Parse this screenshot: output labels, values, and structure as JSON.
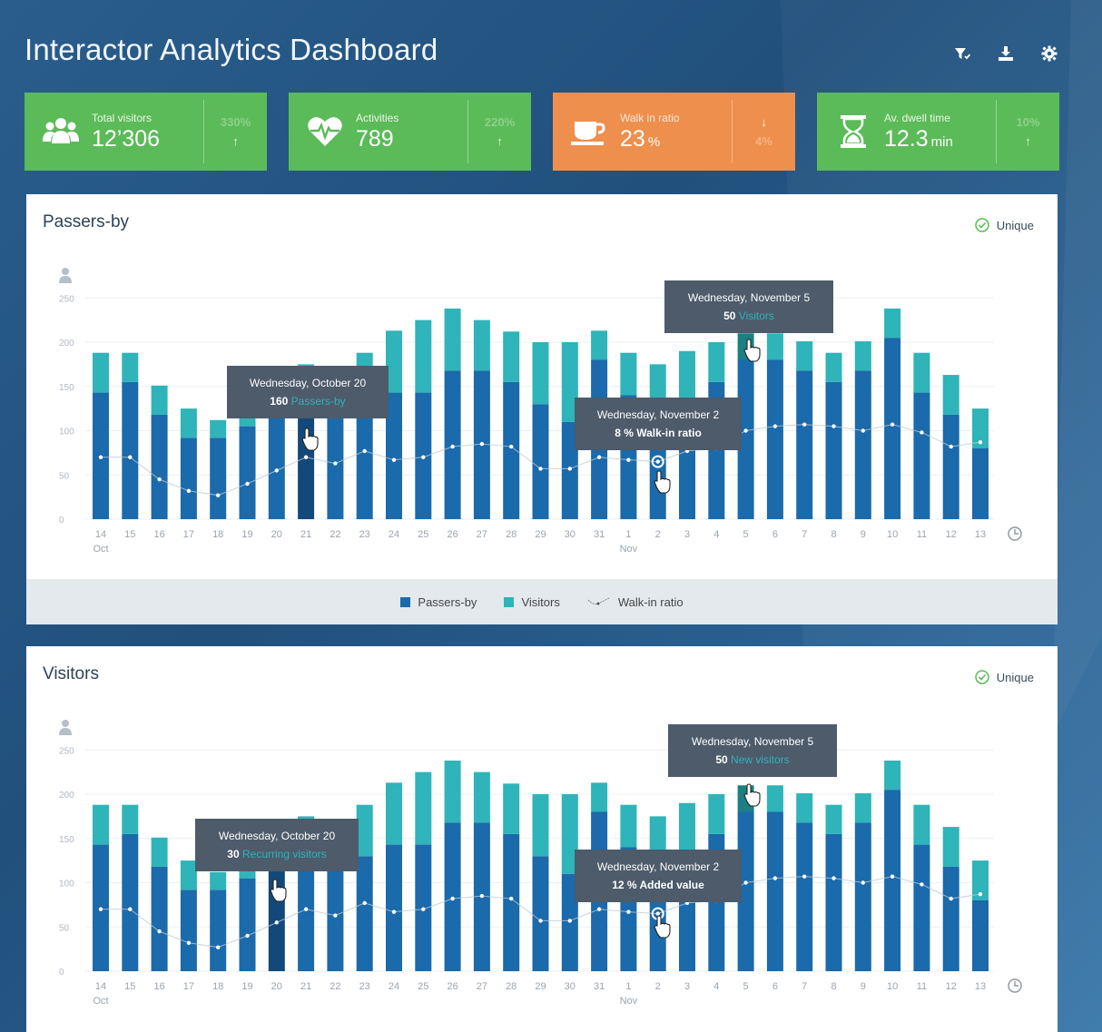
{
  "header": {
    "title": "Interactor Analytics Dashboard",
    "icons": [
      "filter-icon",
      "download-icon",
      "gear-icon"
    ]
  },
  "kpis": [
    {
      "label": "Total visitors",
      "value": "12’306",
      "unit": "",
      "pct": "330%",
      "arrow": "↑",
      "color": "green",
      "icon": "people-icon"
    },
    {
      "label": "Activities",
      "value": "789",
      "unit": "",
      "pct": "220%",
      "arrow": "↑",
      "color": "green",
      "icon": "heartbeat-icon"
    },
    {
      "label": "Walk in ratio",
      "value": "23",
      "unit": "%",
      "pct": "4%",
      "arrow": "↓",
      "color": "orange",
      "icon": "coffee-cup-icon"
    },
    {
      "label": "Av. dwell time",
      "value": "12.3",
      "unit": "min",
      "pct": "10%",
      "arrow": "↑",
      "color": "green",
      "icon": "hourglass-icon"
    }
  ],
  "colors": {
    "passers": "#1b6aab",
    "visitors": "#2eb4b9",
    "kpi_green": "#5bbb58",
    "kpi_orange": "#ee8f4d",
    "tooltip": "#4d5b6b",
    "tooltip_accent": "#2eb4b9"
  },
  "panels": {
    "passersby": {
      "title": "Passers-by",
      "unique_label": "Unique"
    },
    "visitors": {
      "title": "Visitors",
      "unique_label": "Unique"
    }
  },
  "legend": {
    "passers": "Passers-by",
    "visitors": "Visitors",
    "ratio": "Walk-in ratio"
  },
  "chart_data": [
    {
      "type": "bar",
      "stacked": true,
      "title": "Passers-by",
      "y_ticks": [
        0,
        50,
        100,
        150,
        200,
        250
      ],
      "ylim": [
        0,
        250
      ],
      "categories": [
        "14",
        "15",
        "16",
        "17",
        "18",
        "19",
        "20",
        "21",
        "22",
        "23",
        "24",
        "25",
        "26",
        "27",
        "28",
        "29",
        "30",
        "31",
        "1",
        "2",
        "3",
        "4",
        "5",
        "6",
        "7",
        "8",
        "9",
        "10",
        "11",
        "12",
        "13"
      ],
      "month_labels": [
        {
          "index": 0,
          "label": "Oct"
        },
        {
          "index": 18,
          "label": "Nov"
        }
      ],
      "series": [
        {
          "name": "Passers-by",
          "values": [
            143,
            155,
            118,
            92,
            92,
            105,
            115,
            160,
            125,
            130,
            143,
            143,
            168,
            168,
            155,
            130,
            110,
            180,
            140,
            120,
            135,
            155,
            180,
            180,
            168,
            155,
            168,
            205,
            143,
            118,
            80
          ]
        },
        {
          "name": "Visitors",
          "values": [
            45,
            33,
            33,
            33,
            20,
            20,
            40,
            15,
            30,
            58,
            70,
            82,
            70,
            57,
            57,
            70,
            90,
            33,
            48,
            55,
            55,
            45,
            30,
            30,
            33,
            33,
            33,
            33,
            45,
            45,
            45
          ]
        },
        {
          "name": "Walk-in ratio",
          "values": [
            70,
            70,
            45,
            32,
            27,
            40,
            55,
            70,
            63,
            77,
            67,
            70,
            82,
            85,
            82,
            57,
            57,
            70,
            67,
            65,
            77,
            80,
            100,
            105,
            107,
            105,
            100,
            107,
            98,
            82,
            87
          ]
        }
      ],
      "tooltips": [
        {
          "date": "Wednesday, October 20",
          "value": "160",
          "label": "Passers-by"
        },
        {
          "date": "Wednesday, November 5",
          "value": "50",
          "label": "Visitors"
        },
        {
          "date": "Wednesday, November 2",
          "text": "8 % Walk-in ratio"
        }
      ]
    },
    {
      "type": "bar",
      "stacked": true,
      "title": "Visitors",
      "y_ticks": [
        0,
        50,
        100,
        150,
        200,
        250
      ],
      "ylim": [
        0,
        250
      ],
      "categories": [
        "14",
        "15",
        "16",
        "17",
        "18",
        "19",
        "20",
        "21",
        "22",
        "23",
        "24",
        "25",
        "26",
        "27",
        "28",
        "29",
        "30",
        "31",
        "1",
        "2",
        "3",
        "4",
        "5",
        "6",
        "7",
        "8",
        "9",
        "10",
        "11",
        "12",
        "13"
      ],
      "month_labels": [
        {
          "index": 0,
          "label": "Oct"
        },
        {
          "index": 18,
          "label": "Nov"
        }
      ],
      "series": [
        {
          "values": [
            143,
            155,
            118,
            92,
            92,
            105,
            115,
            140,
            125,
            130,
            143,
            143,
            168,
            168,
            155,
            130,
            110,
            180,
            140,
            120,
            135,
            155,
            180,
            180,
            168,
            155,
            168,
            205,
            143,
            118,
            80
          ]
        },
        {
          "values": [
            45,
            33,
            33,
            33,
            20,
            20,
            40,
            35,
            30,
            58,
            70,
            82,
            70,
            57,
            57,
            70,
            90,
            33,
            48,
            55,
            55,
            45,
            30,
            30,
            33,
            33,
            33,
            33,
            45,
            45,
            45
          ]
        },
        {
          "values": [
            70,
            70,
            45,
            32,
            27,
            40,
            55,
            70,
            63,
            77,
            67,
            70,
            82,
            85,
            82,
            57,
            57,
            70,
            67,
            65,
            77,
            80,
            100,
            105,
            107,
            105,
            100,
            107,
            98,
            82,
            87
          ]
        }
      ],
      "tooltips": [
        {
          "date": "Wednesday, October 20",
          "value": "30",
          "label": "Recurring visitors"
        },
        {
          "date": "Wednesday, November 5",
          "value": "50",
          "label": "New visitors"
        },
        {
          "date": "Wednesday, November 2",
          "text": "12 % Added value"
        }
      ]
    }
  ]
}
